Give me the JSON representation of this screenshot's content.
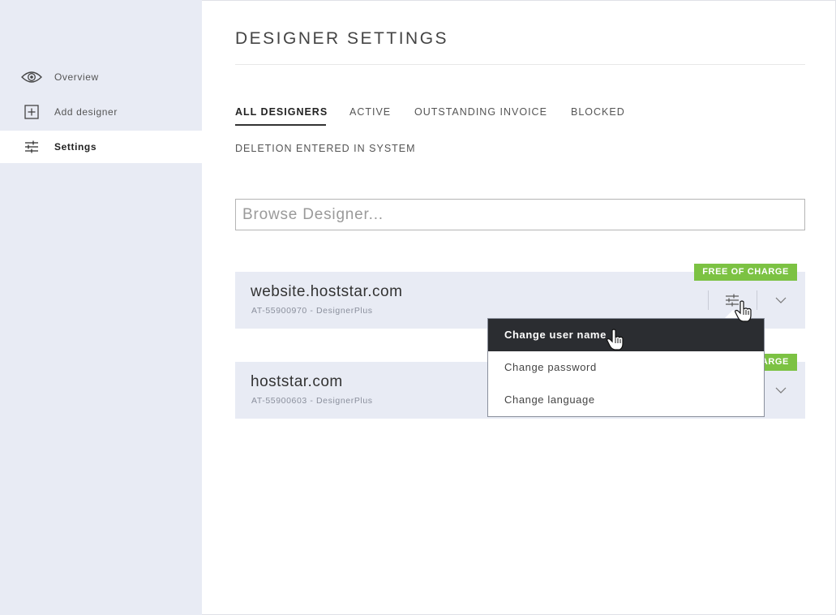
{
  "sidebar": {
    "items": [
      {
        "label": "Overview",
        "icon": "eye-icon"
      },
      {
        "label": "Add designer",
        "icon": "plus-square-icon"
      },
      {
        "label": "Settings",
        "icon": "sliders-icon",
        "active": true
      }
    ]
  },
  "main": {
    "title": "DESIGNER SETTINGS",
    "tabs": [
      {
        "label": "ALL DESIGNERS",
        "active": true
      },
      {
        "label": "ACTIVE"
      },
      {
        "label": "OUTSTANDING INVOICE"
      },
      {
        "label": "BLOCKED"
      },
      {
        "label": "DELETION ENTERED IN SYSTEM"
      }
    ],
    "search": {
      "placeholder": "Browse Designer..."
    },
    "designers": [
      {
        "domain": "website.hoststar.com",
        "meta": "AT-55900970 - DesignerPlus",
        "badge": "FREE OF CHARGE"
      },
      {
        "domain": "hoststar.com",
        "meta": "AT-55900603 - DesignerPlus",
        "badge": "FREE OF CHARGE"
      }
    ]
  },
  "dropdown": {
    "items": [
      {
        "label": "Change user name",
        "hover": true
      },
      {
        "label": "Change password"
      },
      {
        "label": "Change language"
      }
    ]
  },
  "colors": {
    "sidebar_bg": "#e8ebf4",
    "badge_green": "#7cc243",
    "menu_hover": "#2b2d31"
  }
}
